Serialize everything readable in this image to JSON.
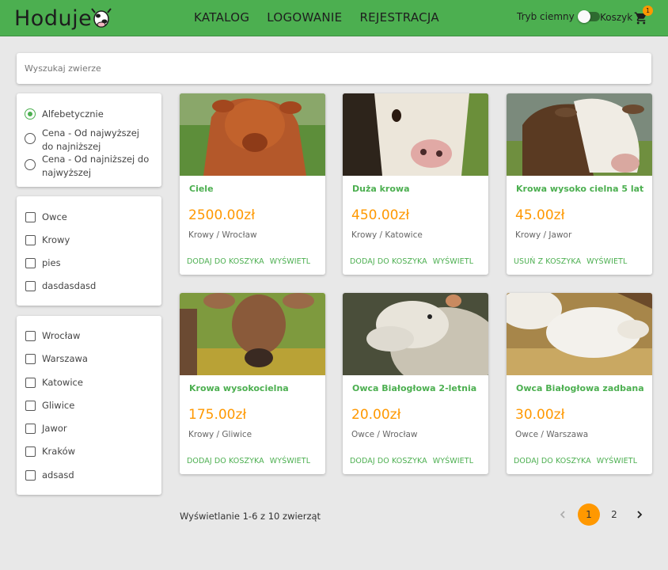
{
  "header": {
    "logo_text": "Hoduje",
    "nav": [
      "KATALOG",
      "LOGOWANIE",
      "REJESTRACJA"
    ],
    "dark_mode_label": "Tryb ciemny",
    "cart_label": "Koszyk",
    "cart_count": "1"
  },
  "search": {
    "placeholder": "Wyszukaj zwierze"
  },
  "sort": {
    "options": [
      "Alfebetycznie",
      "Cena - Od najwyższej do najniższej",
      "Cena - Od najniższej do najwyższej"
    ],
    "selected": "Alfebetycznie"
  },
  "categories": [
    "Owce",
    "Krowy",
    "pies",
    "dasdasdasd"
  ],
  "cities": [
    "Wrocław",
    "Warszawa",
    "Katowice",
    "Gliwice",
    "Jawor",
    "Kraków",
    "adsasd"
  ],
  "products": [
    {
      "name": "Ciele",
      "price": "2500.00zł",
      "meta": "Krowy / Wrocław",
      "cart_action": "DODAJ DO KOSZYKA",
      "view_action": "WYŚWIETL"
    },
    {
      "name": "Duża krowa",
      "price": "450.00zł",
      "meta": "Krowy / Katowice",
      "cart_action": "DODAJ DO KOSZYKA",
      "view_action": "WYŚWIETL"
    },
    {
      "name": "Krowa wysoko cielna 5 lat",
      "price": "45.00zł",
      "meta": "Krowy / Jawor",
      "cart_action": "USUŃ Z KOSZYKA",
      "view_action": "WYŚWIETL"
    },
    {
      "name": "Krowa wysokocielna",
      "price": "175.00zł",
      "meta": "Krowy / Gliwice",
      "cart_action": "DODAJ DO KOSZYKA",
      "view_action": "WYŚWIETL"
    },
    {
      "name": "Owca Białogłowa 2-letnia",
      "price": "20.00zł",
      "meta": "Owce / Wrocław",
      "cart_action": "DODAJ DO KOSZYKA",
      "view_action": "WYŚWIETL"
    },
    {
      "name": "Owca Białogłowa zadbana",
      "price": "30.00zł",
      "meta": "Owce / Warszawa",
      "cart_action": "DODAJ DO KOSZYKA",
      "view_action": "WYŚWIETL"
    }
  ],
  "pagination": {
    "info": "Wyświetlanie 1-6 z 10 zwierząt",
    "pages": [
      "1",
      "2"
    ],
    "current": "1"
  },
  "colors": {
    "primary": "#4caf50",
    "accent": "#ff9800",
    "background": "#e8e8e8"
  }
}
